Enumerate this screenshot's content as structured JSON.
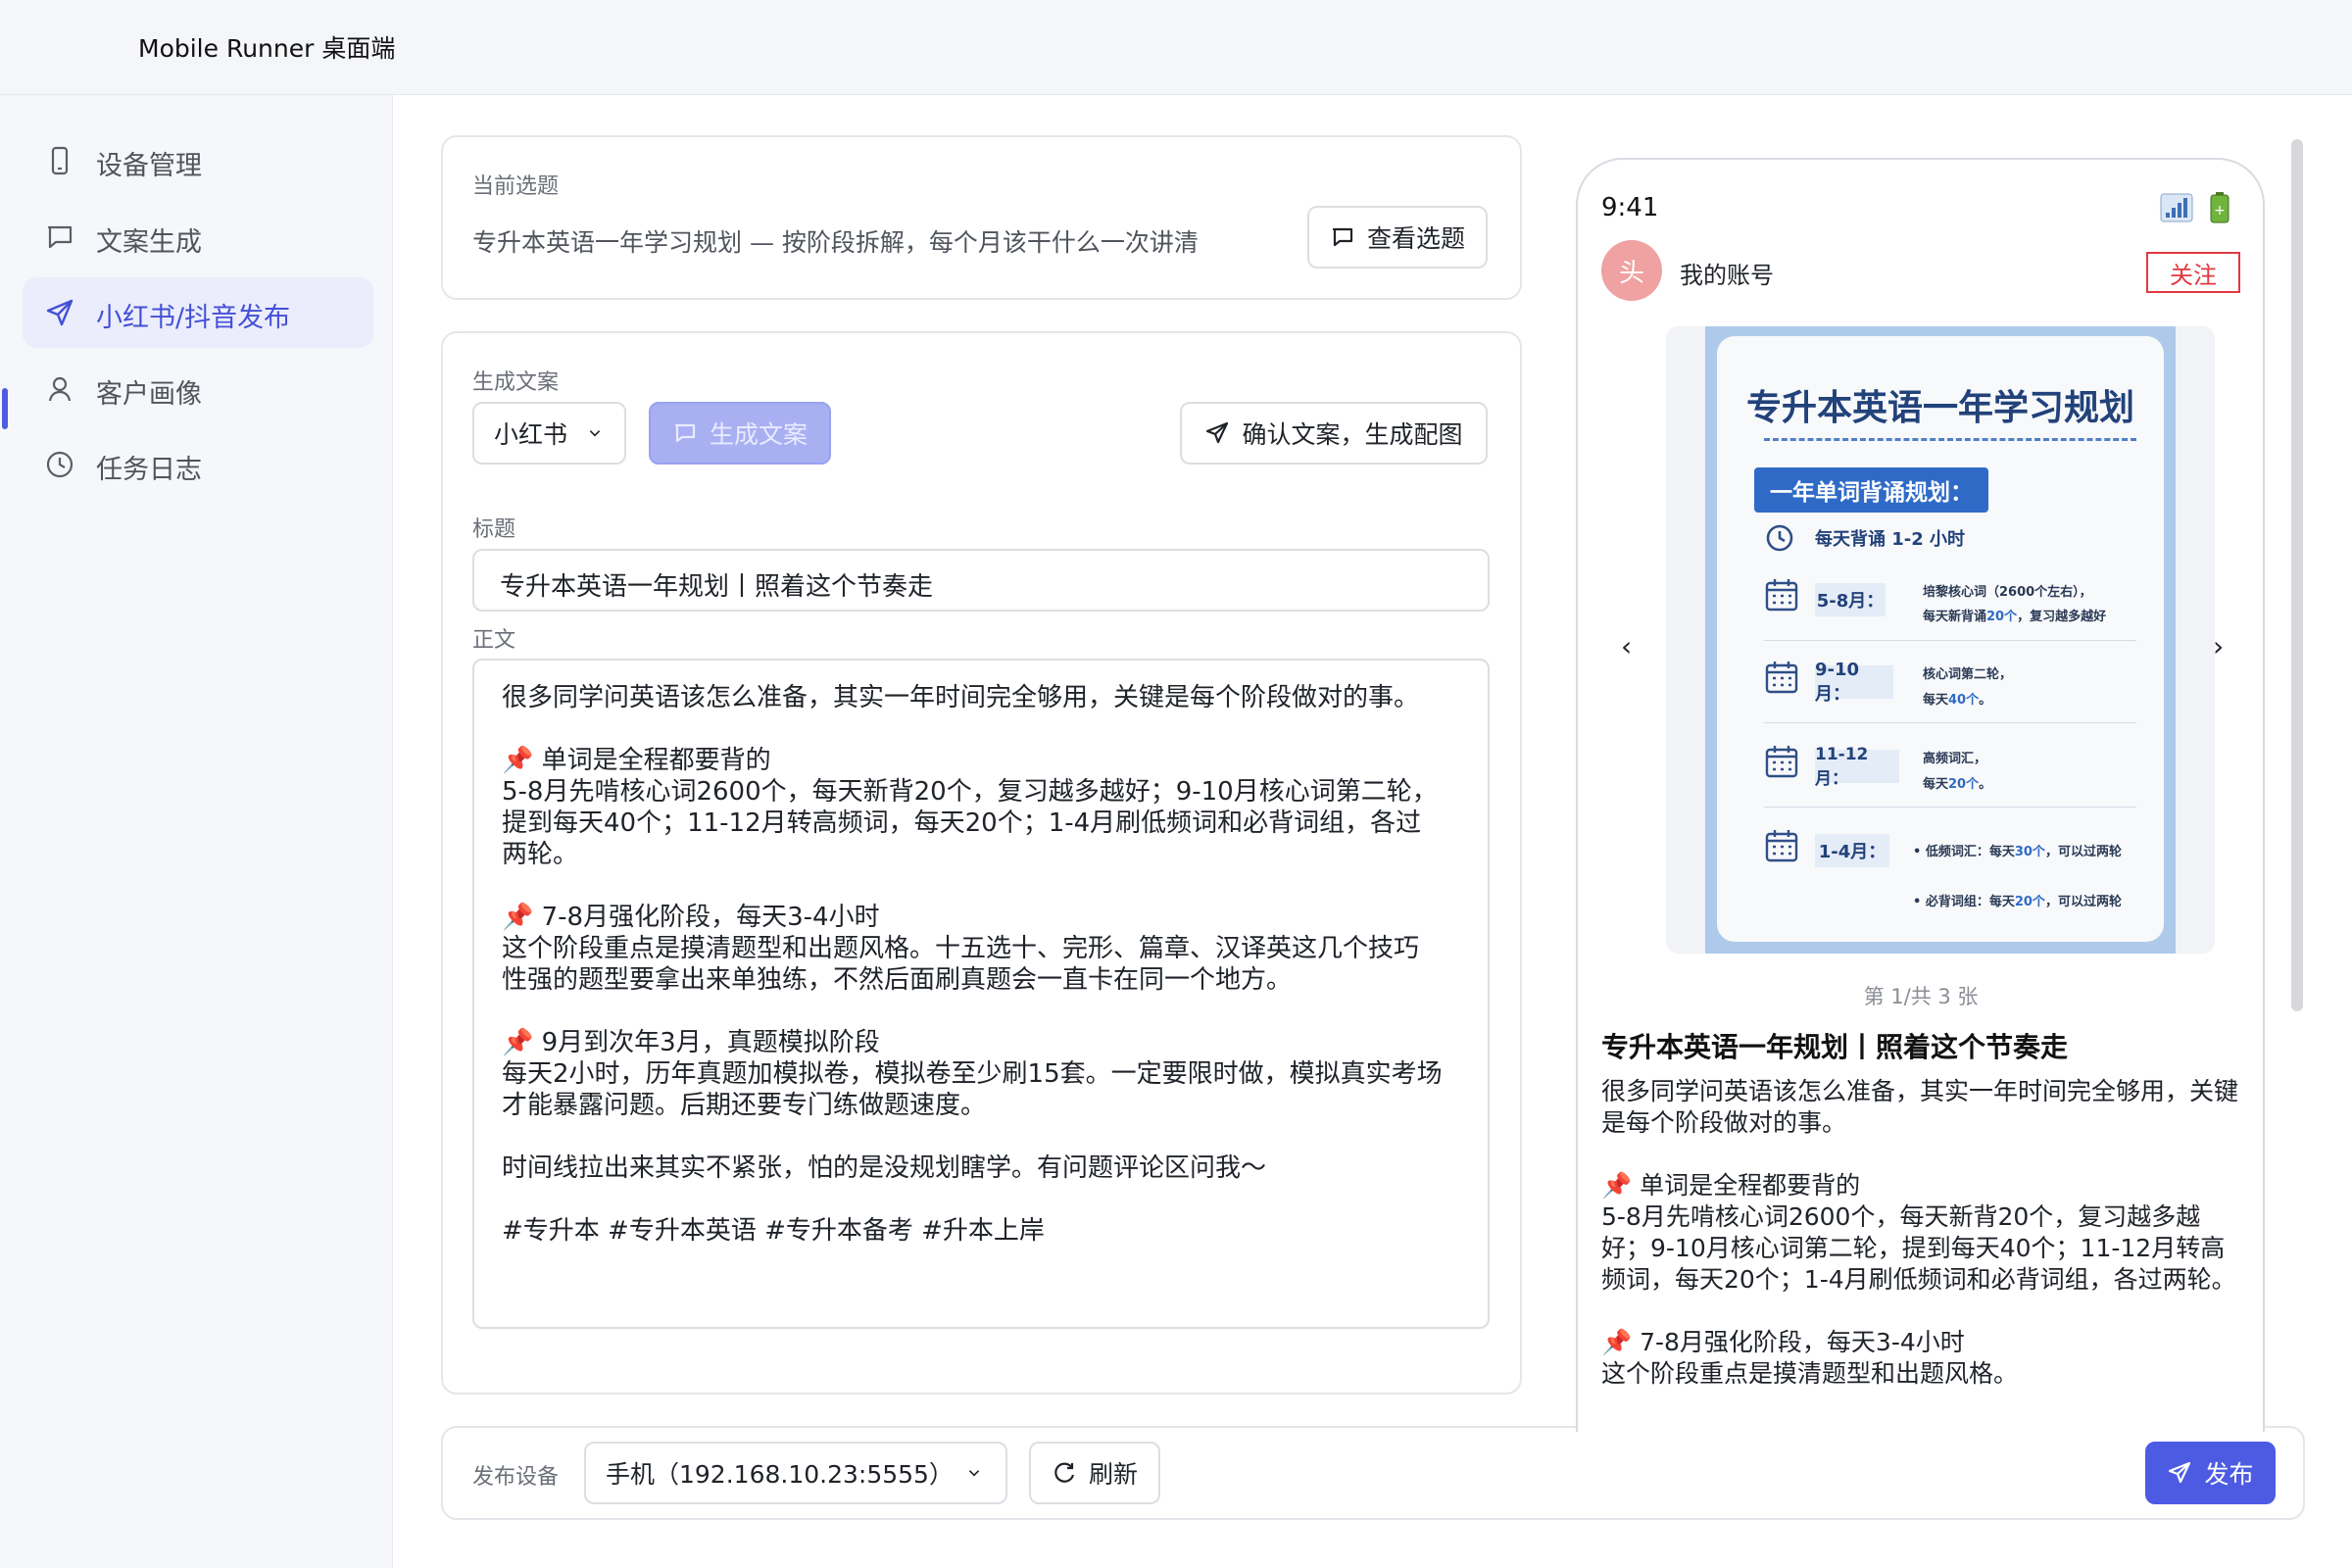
{
  "app": {
    "title": "Mobile Runner 桌面端"
  },
  "sidebar": {
    "items": [
      {
        "label": "设备管理",
        "icon": "phone-icon"
      },
      {
        "label": "文案生成",
        "icon": "message-icon"
      },
      {
        "label": "小红书/抖音发布",
        "icon": "send-icon",
        "active": true
      },
      {
        "label": "客户画像",
        "icon": "user-icon"
      },
      {
        "label": "任务日志",
        "icon": "clock-icon"
      }
    ]
  },
  "topic": {
    "label": "当前选题",
    "text": "专升本英语一年学习规划 — 按阶段拆解，每个月该干什么一次讲清",
    "view_button": "查看选题"
  },
  "generate": {
    "label": "生成文案",
    "platform": "小红书",
    "generate_button": "生成文案",
    "confirm_button": "确认文案，生成配图",
    "title_label": "标题",
    "title_value": "专升本英语一年规划丨照着这个节奏走",
    "body_label": "正文",
    "body_value": "很多同学问英语该怎么准备，其实一年时间完全够用，关键是每个阶段做对的事。\n\n📌 单词是全程都要背的\n5-8月先啃核心词2600个，每天新背20个，复习越多越好；9-10月核心词第二轮，提到每天40个；11-12月转高频词，每天20个；1-4月刷低频词和必背词组，各过两轮。\n\n📌 7-8月强化阶段，每天3-4小时\n这个阶段重点是摸清题型和出题风格。十五选十、完形、篇章、汉译英这几个技巧性强的题型要拿出来单独练，不然后面刷真题会一直卡在同一个地方。\n\n📌 9月到次年3月，真题模拟阶段\n每天2小时，历年真题加模拟卷，模拟卷至少刷15套。一定要限时做，模拟真实考场才能暴露问题。后期还要专门练做题速度。\n\n时间线拉出来其实不紧张，怕的是没规划瞎学。有问题评论区问我～\n\n#专升本 #专升本英语 #专升本备考 #升本上岸"
  },
  "publish": {
    "device_label": "发布设备",
    "device_value": "手机（192.168.10.23:5555）",
    "refresh_button": "刷新",
    "publish_button": "发布"
  },
  "preview": {
    "time": "9:41",
    "avatar_char": "头",
    "account": "我的账号",
    "follow": "关注",
    "page_indicator": "第 1/共 3 张",
    "prev": "‹",
    "next": "›",
    "post_title": "专升本英语一年规划丨照着这个节奏走",
    "post_body": "很多同学问英语该怎么准备，其实一年时间完全够用，关键是每个阶段做对的事。\n\n📌 单词是全程都要背的\n5-8月先啃核心词2600个，每天新背20个，复习越多越好；9-10月核心词第二轮，提到每天40个；11-12月转高频词，每天20个；1-4月刷低频词和必背词组，各过两轮。\n\n📌 7-8月强化阶段，每天3-4小时\n这个阶段重点是摸清题型和出题风格。",
    "image": {
      "title": "专升本英语一年学习规划",
      "subtitle": "一年单词背诵规划：",
      "daily": "每天背诵 1-2 小时",
      "rows": [
        {
          "period": "5-8月：",
          "line1": "培黎核心词（2600个左右），",
          "line2a": "每天新背诵",
          "line2b": "20个",
          "line2c": "，复习越多越好"
        },
        {
          "period": "9-10月：",
          "line1": "核心词第二轮，",
          "line2a": "每天",
          "line2b": "40个",
          "line2c": "。"
        },
        {
          "period": "11-12月：",
          "line1": "高频词汇，",
          "line2a": "每天",
          "line2b": "20个",
          "line2c": "。"
        },
        {
          "period": "1-4月：",
          "line1a": "• 低频词汇：每天",
          "line1b": "30个",
          "line1c": "，可以过两轮",
          "line2a": "• 必背词组：每天",
          "line2b": "20个",
          "line2c": "，可以过两轮"
        }
      ]
    }
  }
}
